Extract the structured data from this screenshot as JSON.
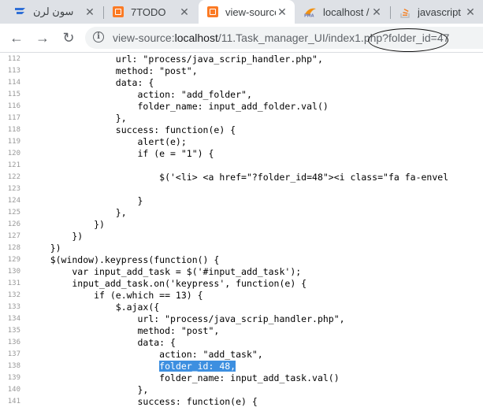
{
  "tabs": [
    {
      "label": "سون لرن",
      "close": "✕"
    },
    {
      "label": "7TODO",
      "close": "✕"
    },
    {
      "label": "view-source",
      "close": "✕"
    },
    {
      "label": "localhost /",
      "close": "✕"
    },
    {
      "label": "javascript -",
      "close": "✕"
    }
  ],
  "toolbar": {
    "back_icon": "←",
    "forward_icon": "→",
    "reload_icon": "↻",
    "url_prefix": "view-source:",
    "url_host": "localhost",
    "url_path": "/11.Task_manager_UI/index1.php?folder_id=47"
  },
  "source_lines": [
    {
      "num": "112",
      "text": "                url: \"process/java_scrip_handler.php\","
    },
    {
      "num": "113",
      "text": "                method: \"post\","
    },
    {
      "num": "114",
      "text": "                data: {"
    },
    {
      "num": "115",
      "text": "                    action: \"add_folder\","
    },
    {
      "num": "116",
      "text": "                    folder_name: input_add_folder.val()"
    },
    {
      "num": "117",
      "text": "                },"
    },
    {
      "num": "118",
      "text": "                success: function(e) {"
    },
    {
      "num": "119",
      "text": "                    alert(e);"
    },
    {
      "num": "120",
      "text": "                    if (e = \"1\") {"
    },
    {
      "num": "121",
      "text": ""
    },
    {
      "num": "122",
      "text": "                        $('<li> <a href=\"?folder_id=48\"><i class=\"fa fa-envel"
    },
    {
      "num": "123",
      "text": ""
    },
    {
      "num": "124",
      "text": "                    }"
    },
    {
      "num": "125",
      "text": "                },"
    },
    {
      "num": "126",
      "text": "            })"
    },
    {
      "num": "127",
      "text": "        })"
    },
    {
      "num": "128",
      "text": "    })"
    },
    {
      "num": "129",
      "text": "    $(window).keypress(function() {"
    },
    {
      "num": "130",
      "text": "        var input_add_task = $('#input_add_task');"
    },
    {
      "num": "131",
      "text": "        input_add_task.on('keypress', function(e) {"
    },
    {
      "num": "132",
      "text": "            if (e.which == 13) {"
    },
    {
      "num": "133",
      "text": "                $.ajax({"
    },
    {
      "num": "134",
      "text": "                    url: \"process/java_scrip_handler.php\","
    },
    {
      "num": "135",
      "text": "                    method: \"post\","
    },
    {
      "num": "136",
      "text": "                    data: {"
    },
    {
      "num": "137",
      "text": "                        action: \"add_task\","
    },
    {
      "num": "138",
      "indent": "                        ",
      "highlight": "folder_id: 48,",
      "text": ""
    },
    {
      "num": "139",
      "text": "                        folder_name: input_add_task.val()"
    },
    {
      "num": "140",
      "text": "                    },"
    },
    {
      "num": "141",
      "text": "                    success: function(e) {"
    }
  ],
  "colors": {
    "tabstrip": "#dee1e6",
    "xampp_orange": "#fb7a24",
    "selection": "#3d8fe0",
    "line_number": "#999999"
  }
}
